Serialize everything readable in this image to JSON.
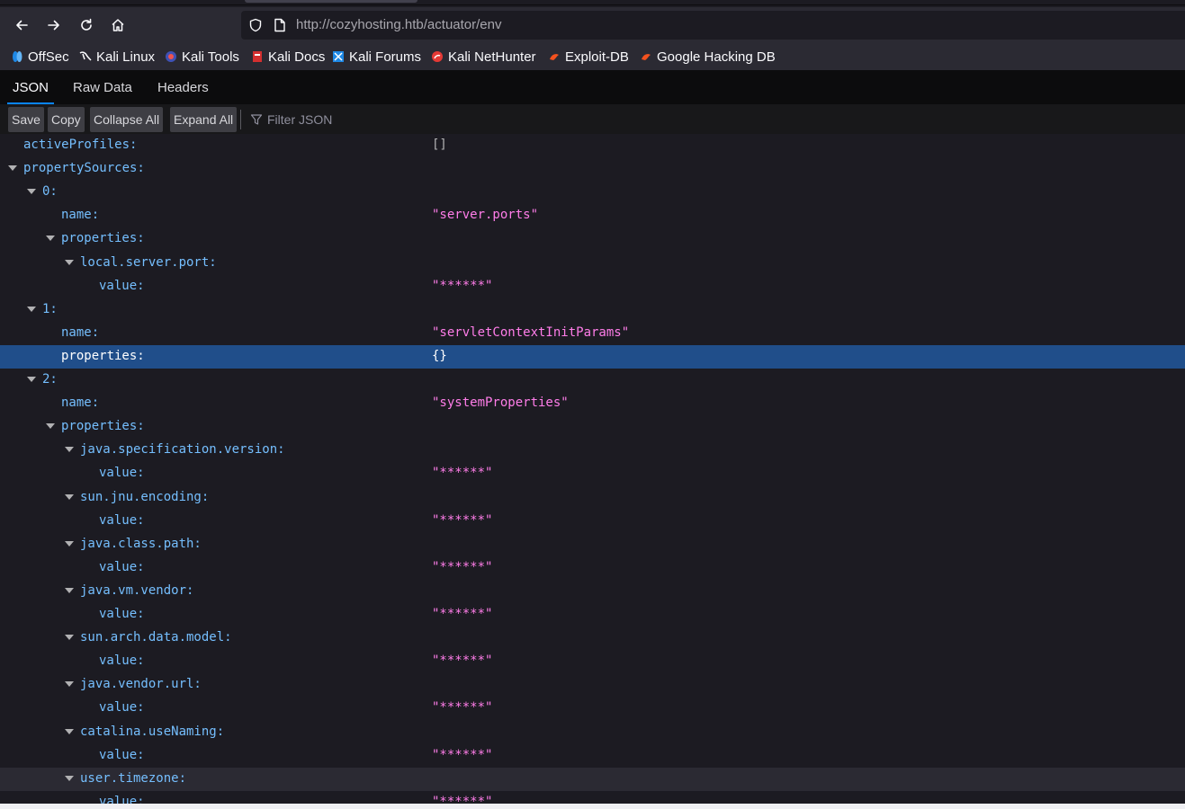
{
  "browser": {
    "url_host": "http://cozyhosting.htb",
    "url_path": "/actuator/env"
  },
  "bookmarks": [
    {
      "label": "OffSec",
      "icon": "offsec-icon"
    },
    {
      "label": "Kali Linux",
      "icon": "kali-dragon-icon"
    },
    {
      "label": "Kali Tools",
      "icon": "kali-tools-icon"
    },
    {
      "label": "Kali Docs",
      "icon": "kali-docs-icon"
    },
    {
      "label": "Kali Forums",
      "icon": "kali-forums-icon"
    },
    {
      "label": "Kali NetHunter",
      "icon": "kali-nethunter-icon"
    },
    {
      "label": "Exploit-DB",
      "icon": "exploit-db-icon"
    },
    {
      "label": "Google Hacking DB",
      "icon": "ghdb-icon"
    }
  ],
  "viewer": {
    "tabs": [
      "JSON",
      "Raw Data",
      "Headers"
    ],
    "active_tab": "JSON",
    "buttons": [
      "Save",
      "Copy",
      "Collapse All",
      "Expand All"
    ],
    "filter_placeholder": "Filter JSON"
  },
  "tree": [
    {
      "key": "activeProfiles:",
      "value": "[]",
      "value_type": "obj",
      "expandable": false
    },
    {
      "key": "propertySources:",
      "value": "",
      "expandable": true
    },
    {
      "key": "0:",
      "value": "",
      "expandable": true
    },
    {
      "key": "name:",
      "value": "\"server.ports\"",
      "value_type": "str",
      "expandable": false
    },
    {
      "key": "properties:",
      "value": "",
      "expandable": true
    },
    {
      "key": "local.server.port:",
      "value": "",
      "expandable": true
    },
    {
      "key": "value:",
      "value": "\"******\"",
      "value_type": "str",
      "expandable": false
    },
    {
      "key": "1:",
      "value": "",
      "expandable": true
    },
    {
      "key": "name:",
      "value": "\"servletContextInitParams\"",
      "value_type": "str",
      "expandable": false
    },
    {
      "key": "properties:",
      "value": "{}",
      "value_type": "obj",
      "expandable": false,
      "selected": true
    },
    {
      "key": "2:",
      "value": "",
      "expandable": true
    },
    {
      "key": "name:",
      "value": "\"systemProperties\"",
      "value_type": "str",
      "expandable": false
    },
    {
      "key": "properties:",
      "value": "",
      "expandable": true
    },
    {
      "key": "java.specification.version:",
      "value": "",
      "expandable": true
    },
    {
      "key": "value:",
      "value": "\"******\"",
      "value_type": "str",
      "expandable": false
    },
    {
      "key": "sun.jnu.encoding:",
      "value": "",
      "expandable": true
    },
    {
      "key": "value:",
      "value": "\"******\"",
      "value_type": "str",
      "expandable": false
    },
    {
      "key": "java.class.path:",
      "value": "",
      "expandable": true
    },
    {
      "key": "value:",
      "value": "\"******\"",
      "value_type": "str",
      "expandable": false
    },
    {
      "key": "java.vm.vendor:",
      "value": "",
      "expandable": true
    },
    {
      "key": "value:",
      "value": "\"******\"",
      "value_type": "str",
      "expandable": false
    },
    {
      "key": "sun.arch.data.model:",
      "value": "",
      "expandable": true
    },
    {
      "key": "value:",
      "value": "\"******\"",
      "value_type": "str",
      "expandable": false
    },
    {
      "key": "java.vendor.url:",
      "value": "",
      "expandable": true
    },
    {
      "key": "value:",
      "value": "\"******\"",
      "value_type": "str",
      "expandable": false
    },
    {
      "key": "catalina.useNaming:",
      "value": "",
      "expandable": true
    },
    {
      "key": "value:",
      "value": "\"******\"",
      "value_type": "str",
      "expandable": false
    },
    {
      "key": "user.timezone:",
      "value": "",
      "expandable": true,
      "hover": true
    },
    {
      "key": "value:",
      "value": "\"******\"",
      "value_type": "str",
      "expandable": false
    }
  ]
}
